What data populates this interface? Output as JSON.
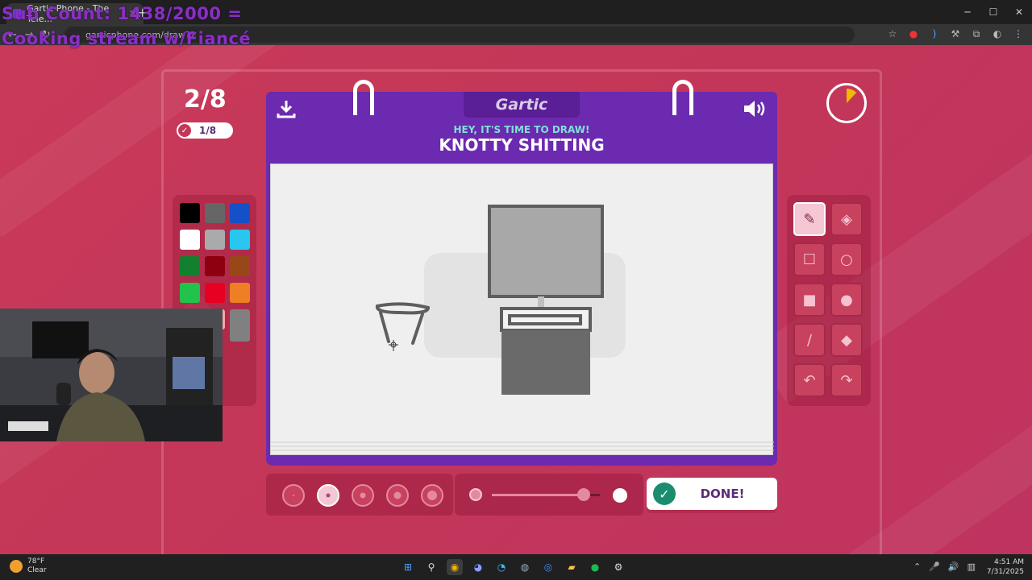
{
  "browser": {
    "tab_title": "Gartic Phone - The Tele...",
    "tab_close": "✕",
    "new_tab": "+",
    "url": "garticphone.com/draw?2",
    "window_controls": [
      "─",
      "☐",
      "✕"
    ]
  },
  "stream_overlay": {
    "line1": "Sub Count: 1438/2000 =",
    "line2": "Cooking stream w/Fiancé"
  },
  "game": {
    "round": "2/8",
    "completed": "1/8",
    "logo": "Gartic",
    "prompt_heading": "HEY, IT'S TIME TO DRAW!",
    "prompt": "KNOTTY SHITTING",
    "done_label": "DONE!",
    "colors": {
      "accent_purple": "#6c2ab0",
      "background": "#c43758",
      "timer_fill": "#f2b705"
    },
    "timer_elapsed_fraction": 0.12,
    "palette": [
      "#000000",
      "#666666",
      "#1450c8",
      "#ffffff",
      "#aaaaaa",
      "#27c7f0",
      "#138030",
      "#8e0010",
      "#984818",
      "#23c24a",
      "#e80020",
      "#ef7f24",
      "#c4485c",
      "#f4a6a6",
      "#808080"
    ],
    "tools": [
      {
        "name": "pencil-tool",
        "icon": "✎"
      },
      {
        "name": "eraser-tool",
        "icon": "◈"
      },
      {
        "name": "rectangle-outline-tool",
        "icon": "☐"
      },
      {
        "name": "ellipse-outline-tool",
        "icon": "○"
      },
      {
        "name": "rectangle-fill-tool",
        "icon": "■"
      },
      {
        "name": "ellipse-fill-tool",
        "icon": "●"
      },
      {
        "name": "line-tool",
        "icon": "/"
      },
      {
        "name": "fill-bucket-tool",
        "icon": "◆"
      },
      {
        "name": "undo-tool",
        "icon": "↶"
      },
      {
        "name": "redo-tool",
        "icon": "↷"
      }
    ],
    "selected_brush_size_index": 1,
    "opacity_level": 0.85
  },
  "taskbar": {
    "temperature": "78°F",
    "condition": "Clear",
    "time": "4:51 AM",
    "date": "7/31/2025"
  }
}
